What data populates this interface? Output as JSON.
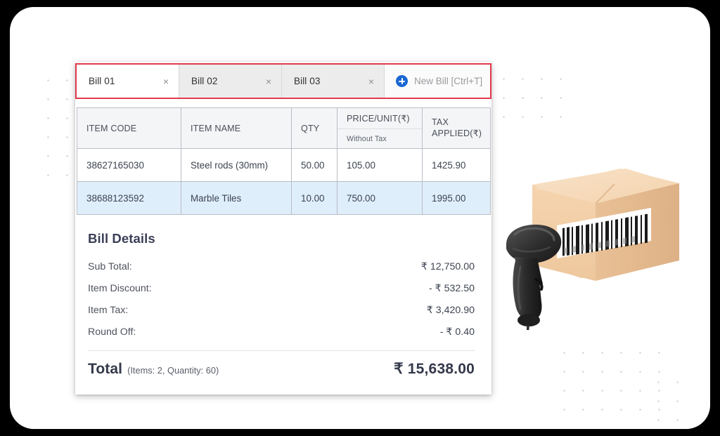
{
  "tabs": {
    "items": [
      {
        "label": "Bill 01",
        "active": true,
        "close_icon": "close-icon"
      },
      {
        "label": "Bill 02",
        "active": false,
        "close_icon": "close-icon"
      },
      {
        "label": "Bill 03",
        "active": false,
        "close_icon": "close-icon"
      }
    ],
    "close_glyph": "×",
    "new_bill": {
      "label": "New Bill [Ctrl+T]",
      "icon": "plus-circle-icon"
    },
    "highlight_color": "#e13a4c"
  },
  "items_table": {
    "columns": [
      {
        "key": "item_code",
        "label": "ITEM CODE"
      },
      {
        "key": "item_name",
        "label": "ITEM NAME"
      },
      {
        "key": "qty",
        "label": "QTY"
      },
      {
        "key": "price_unit",
        "label": "PRICE/UNIT(₹)",
        "sublabel": "Without Tax"
      },
      {
        "key": "tax_applied",
        "label": "TAX APPLIED(₹)"
      }
    ],
    "rows": [
      {
        "item_code": "38627165030",
        "item_name": "Steel rods (30mm)",
        "qty": "50.00",
        "price_unit": "105.00",
        "tax_applied": "1425.90",
        "selected": false
      },
      {
        "item_code": "38688123592",
        "item_name": "Marble Tiles",
        "qty": "10.00",
        "price_unit": "750.00",
        "tax_applied": "1995.00",
        "selected": true
      }
    ],
    "selected_row_color": "#dfeefb"
  },
  "bill_details": {
    "title": "Bill Details",
    "rows": [
      {
        "label": "Sub Total:",
        "value": "₹ 12,750.00"
      },
      {
        "label": "Item Discount:",
        "value": "- ₹ 532.50"
      },
      {
        "label": "Item Tax:",
        "value": "₹ 3,420.90"
      },
      {
        "label": "Round Off:",
        "value": "- ₹ 0.40"
      }
    ],
    "total": {
      "word": "Total",
      "meta": "(Items: 2, Quantity: 60)",
      "value": "₹ 15,638.00"
    }
  },
  "illustration": {
    "name": "barcode-scanner-and-package",
    "box_color": "#f2cfa8",
    "box_top_color": "#f7ddc0",
    "box_side_color": "#e8bd91",
    "label_color": "#ffffff",
    "scanner_color": "#2e2e2e"
  }
}
